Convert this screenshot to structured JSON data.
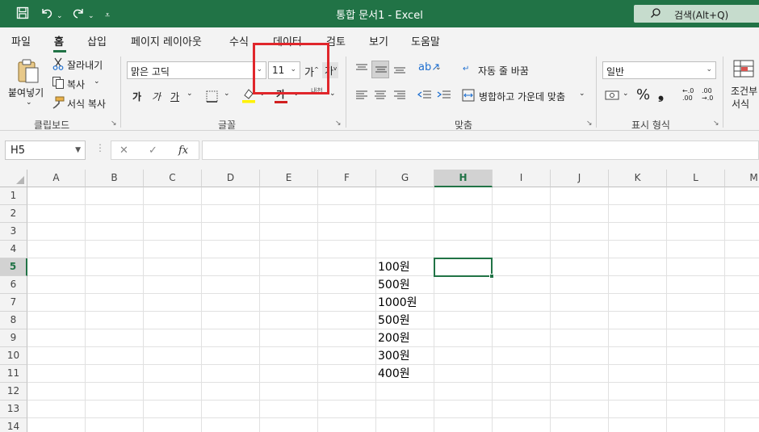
{
  "title_bar": {
    "title": "통합 문서1  -  Excel",
    "search_label": "검색(Alt+Q)",
    "search_icon": "search-icon",
    "quick_access": [
      "save-icon",
      "undo-icon",
      "redo-icon",
      "customize-icon"
    ]
  },
  "tabs": [
    {
      "label": "파일"
    },
    {
      "label": "홈",
      "active": true
    },
    {
      "label": "삽입"
    },
    {
      "label": "페이지 레이아웃"
    },
    {
      "label": "수식"
    },
    {
      "label": "데이터"
    },
    {
      "label": "검토"
    },
    {
      "label": "보기"
    },
    {
      "label": "도움말"
    }
  ],
  "ribbon": {
    "clipboard": {
      "paste": "붙여넣기",
      "cut": "잘라내기",
      "copy": "복사",
      "format_painter": "서식 복사",
      "group_label": "클립보드"
    },
    "font": {
      "font_name": "맑은 고딕",
      "font_size": "11",
      "bold": "가",
      "italic": "가",
      "underline": "가",
      "font_color_glyph": "가",
      "phonetic": "내천",
      "group_label": "글꼴"
    },
    "alignment": {
      "wrap_text": "자동 줄 바꿈",
      "merge_center": "병합하고 가운데 맞춤",
      "group_label": "맞춤"
    },
    "number": {
      "format": "일반",
      "percent": "%",
      "comma": "❟",
      "group_label": "표시 형식"
    },
    "styles": {
      "conditional_line1": "조건부",
      "conditional_line2": "서식"
    }
  },
  "formula_bar": {
    "name_box": "H5",
    "cancel": "✕",
    "enter": "✓",
    "fx": "fx",
    "formula": ""
  },
  "grid": {
    "columns": [
      "A",
      "B",
      "C",
      "D",
      "E",
      "F",
      "G",
      "H",
      "I",
      "J",
      "K",
      "L",
      "M"
    ],
    "rows": [
      "1",
      "2",
      "3",
      "4",
      "5",
      "6",
      "7",
      "8",
      "9",
      "10",
      "11",
      "12",
      "13",
      "14"
    ],
    "selected_column": "H",
    "selected_row": "5",
    "g_values": [
      {
        "row": "5",
        "value": "100원"
      },
      {
        "row": "6",
        "value": "500원"
      },
      {
        "row": "7",
        "value": "1000원"
      },
      {
        "row": "8",
        "value": "500원"
      },
      {
        "row": "9",
        "value": "200원"
      },
      {
        "row": "10",
        "value": "300원"
      },
      {
        "row": "11",
        "value": "400원"
      }
    ]
  },
  "colors": {
    "excel_green": "#217346",
    "highlight_red": "#e0262b"
  }
}
